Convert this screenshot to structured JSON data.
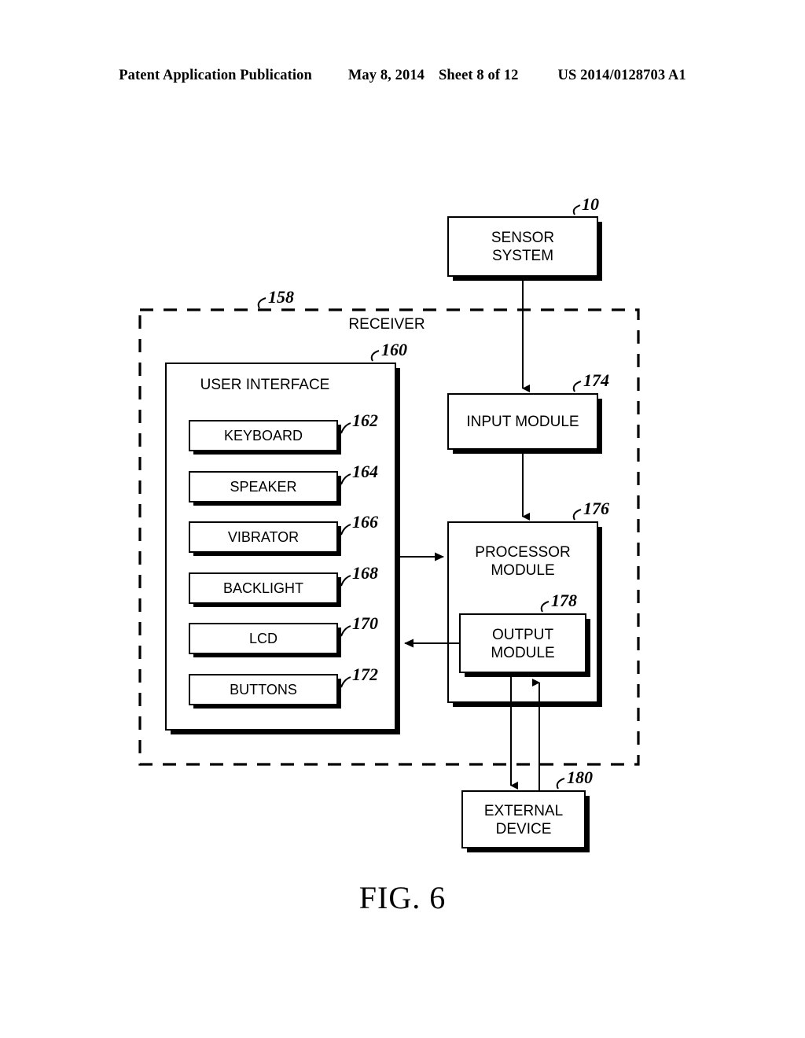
{
  "header": {
    "publication": "Patent Application Publication",
    "date": "May 8, 2014",
    "sheet": "Sheet 8 of 12",
    "patent_number": "US 2014/0128703 A1"
  },
  "figure": {
    "caption": "FIG. 6",
    "type": "block-diagram",
    "boundary": {
      "label": "RECEIVER",
      "ref": "158",
      "style": "dashed"
    },
    "blocks": [
      {
        "id": "sensor-system",
        "label_line1": "SENSOR",
        "label_line2": "SYSTEM",
        "ref": "10",
        "shadowed": true
      },
      {
        "id": "user-interface",
        "label_line1": "USER INTERFACE",
        "label_line2": "",
        "ref": "160",
        "shadowed": true
      },
      {
        "id": "keyboard",
        "label_line1": "KEYBOARD",
        "label_line2": "",
        "ref": "162",
        "shadowed": true
      },
      {
        "id": "speaker",
        "label_line1": "SPEAKER",
        "label_line2": "",
        "ref": "164",
        "shadowed": true
      },
      {
        "id": "vibrator",
        "label_line1": "VIBRATOR",
        "label_line2": "",
        "ref": "166",
        "shadowed": true
      },
      {
        "id": "backlight",
        "label_line1": "BACKLIGHT",
        "label_line2": "",
        "ref": "168",
        "shadowed": true
      },
      {
        "id": "lcd",
        "label_line1": "LCD",
        "label_line2": "",
        "ref": "170",
        "shadowed": true
      },
      {
        "id": "buttons",
        "label_line1": "BUTTONS",
        "label_line2": "",
        "ref": "172",
        "shadowed": true
      },
      {
        "id": "input-module",
        "label_line1": "INPUT MODULE",
        "label_line2": "",
        "ref": "174",
        "shadowed": true
      },
      {
        "id": "processor-module",
        "label_line1": "PROCESSOR",
        "label_line2": "MODULE",
        "ref": "176",
        "shadowed": true
      },
      {
        "id": "output-module",
        "label_line1": "OUTPUT",
        "label_line2": "MODULE",
        "ref": "178",
        "shadowed": true
      },
      {
        "id": "external-device",
        "label_line1": "EXTERNAL",
        "label_line2": "DEVICE",
        "ref": "180",
        "shadowed": true
      }
    ],
    "connections": [
      {
        "from": "sensor-system",
        "to": "input-module",
        "direction": "down"
      },
      {
        "from": "input-module",
        "to": "processor-module",
        "direction": "down"
      },
      {
        "from": "user-interface",
        "to": "processor-module",
        "direction": "right"
      },
      {
        "from": "output-module",
        "to": "user-interface",
        "direction": "left"
      },
      {
        "from": "output-module",
        "to": "external-device",
        "direction": "down"
      },
      {
        "from": "external-device",
        "to": "output-module",
        "direction": "up"
      }
    ]
  }
}
